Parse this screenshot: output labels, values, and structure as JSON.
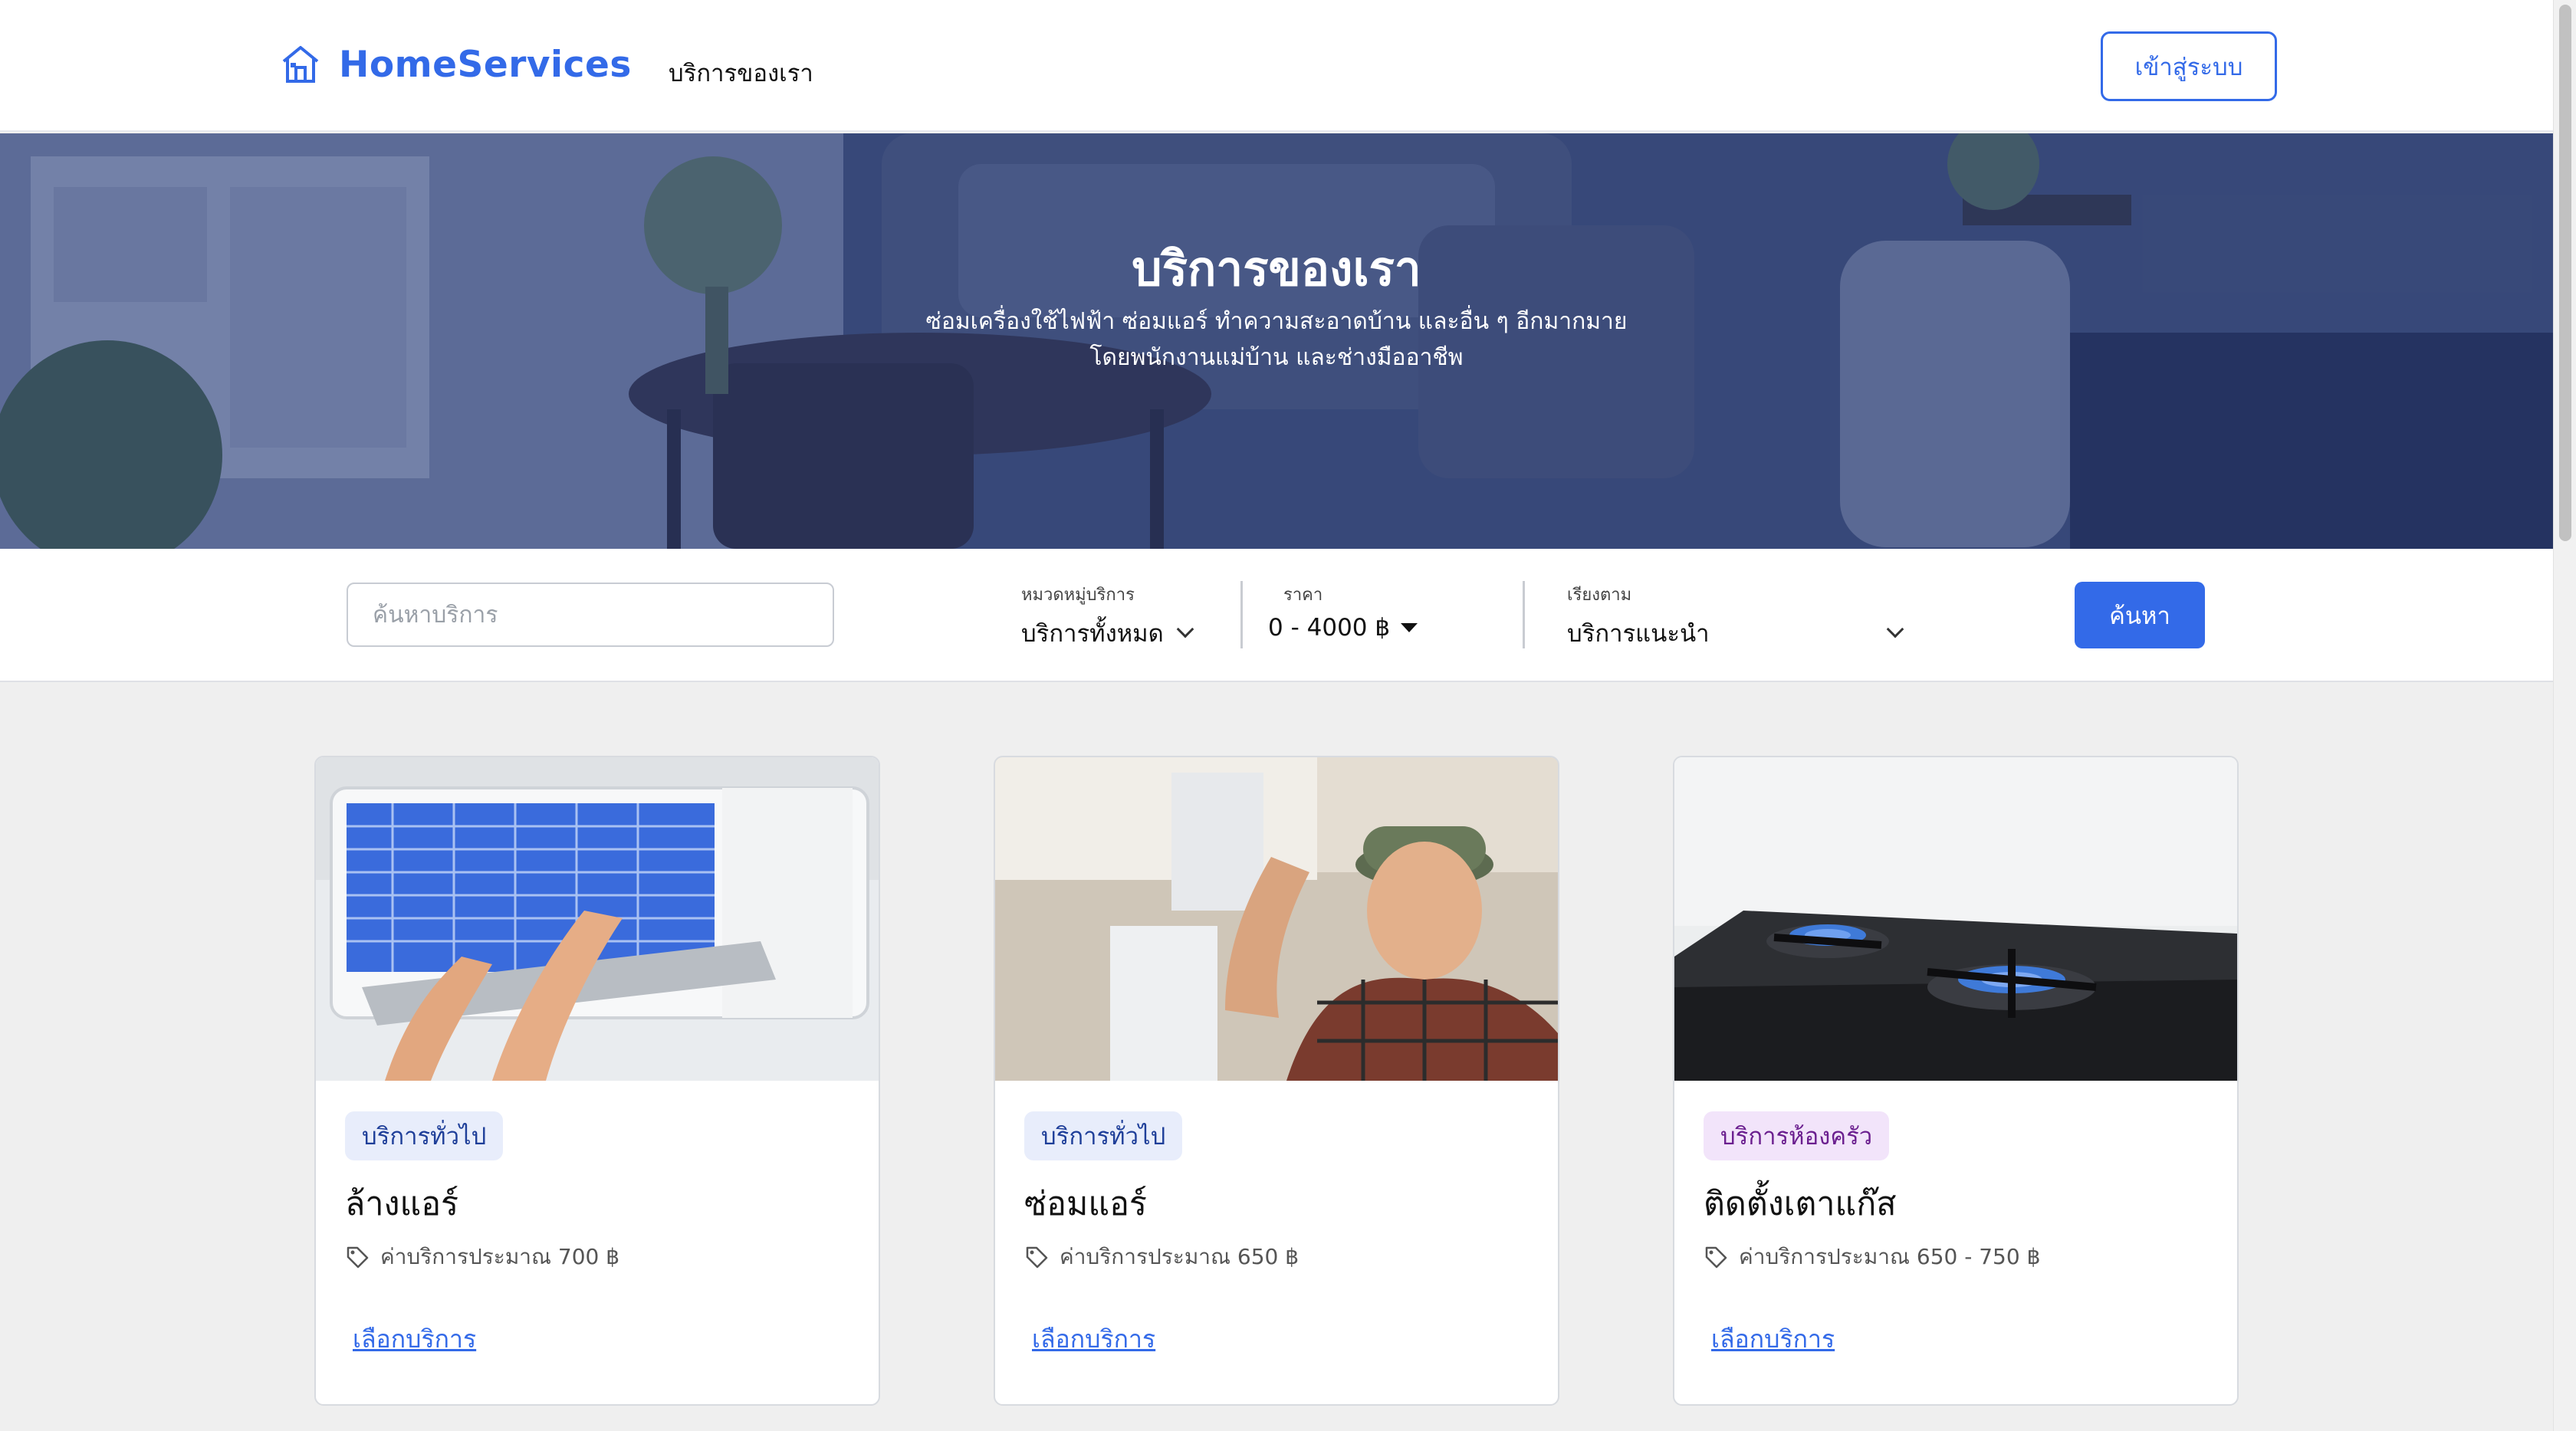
{
  "header": {
    "brand_name": "HomeServices",
    "brand_icon": "house-icon",
    "nav_link": "บริการของเรา",
    "login_label": "เข้าสู่ระบบ"
  },
  "hero": {
    "title": "บริการของเรา",
    "subtitle_line1": "ซ่อมเครื่องใช้ไฟฟ้า ซ่อมแอร์ ทำความสะอาดบ้าน และอื่น ๆ อีกมากมาย",
    "subtitle_line2": "โดยพนักงานแม่บ้าน และช่างมืออาชีพ"
  },
  "filters": {
    "search_placeholder": "ค้นหาบริการ",
    "category_label": "หมวดหมู่บริการ",
    "category_value": "บริการทั้งหมด",
    "price_label": "ราคา",
    "price_value": "0 - 4000 ฿",
    "sort_label": "เรียงตาม",
    "sort_value": "บริการแนะนำ",
    "search_button": "ค้นหา"
  },
  "services": [
    {
      "category": "บริการทั่วไป",
      "title": "ล้างแอร์",
      "price": "ค่าบริการประมาณ 700 ฿",
      "link": "เลือกบริการ"
    },
    {
      "category": "บริการทั่วไป",
      "title": "ซ่อมแอร์",
      "price": "ค่าบริการประมาณ 650 ฿",
      "link": "เลือกบริการ"
    },
    {
      "category": "บริการห้องครัว",
      "title": "ติดตั้งเตาแก๊ส",
      "price": "ค่าบริการประมาณ 650 - 750 ฿",
      "link": "เลือกบริการ"
    }
  ],
  "colors": {
    "accent": "#336ae8",
    "badge_general_bg": "#e8edfb",
    "badge_kitchen_bg": "#f2e4fa"
  }
}
